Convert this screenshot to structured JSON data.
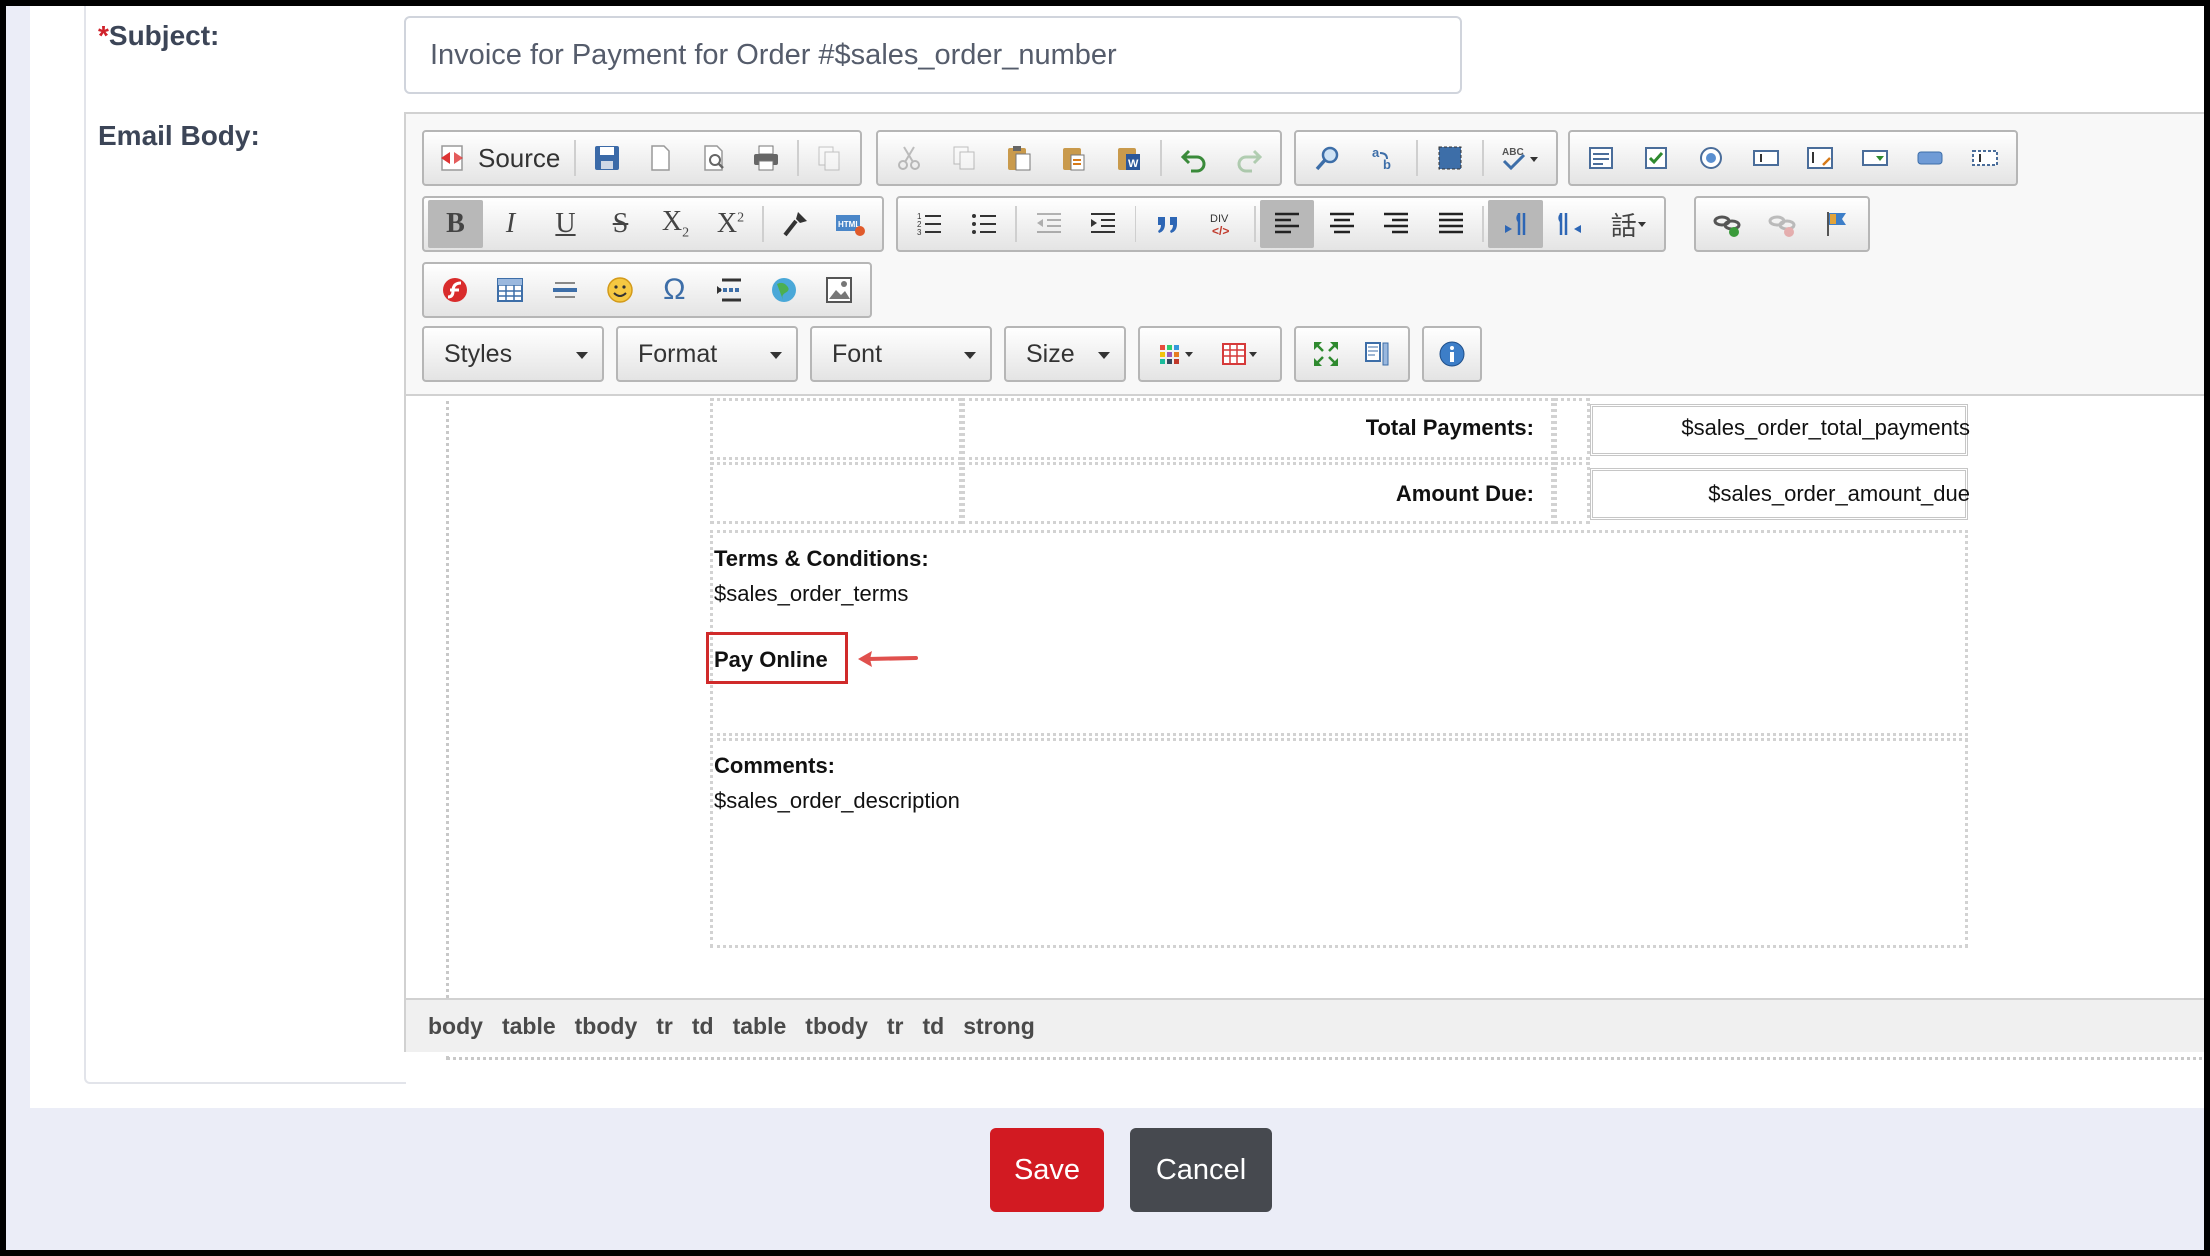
{
  "form": {
    "subject_required_mark": "*",
    "subject_label": "Subject:",
    "subject_value": "Invoice for Payment for Order #$sales_order_number",
    "body_label": "Email Body:"
  },
  "toolbar": {
    "source_label": "Source",
    "styles_label": "Styles",
    "format_label": "Format",
    "font_label": "Font",
    "size_label": "Size",
    "icons_row1": [
      "save-icon",
      "new-page-icon",
      "preview-icon",
      "print-icon",
      "templates-icon",
      "cut-icon",
      "copy-icon",
      "paste-icon",
      "paste-text-icon",
      "paste-word-icon",
      "undo-icon",
      "redo-icon",
      "find-icon",
      "replace-icon",
      "select-all-icon",
      "spellcheck-icon",
      "form-icon",
      "checkbox-icon",
      "radio-icon",
      "textfield-icon",
      "textarea-icon",
      "select-field-icon",
      "button-icon",
      "hidden-field-icon"
    ],
    "icons_row2": [
      "bold-icon",
      "italic-icon",
      "underline-icon",
      "strike-icon",
      "subscript-icon",
      "superscript-icon",
      "copy-format-icon",
      "remove-format-icon",
      "numbered-list-icon",
      "bulleted-list-icon",
      "outdent-icon",
      "indent-icon",
      "blockquote-icon",
      "div-icon",
      "align-left-icon",
      "align-center-icon",
      "align-right-icon",
      "justify-icon",
      "ltr-icon",
      "rtl-icon",
      "language-icon",
      "link-icon",
      "unlink-icon",
      "anchor-icon"
    ],
    "icons_row3": [
      "flash-icon",
      "table-icon",
      "horizontal-rule-icon",
      "smiley-icon",
      "special-char-icon",
      "page-break-icon",
      "iframe-icon",
      "image-icon"
    ],
    "text_color_icon": "text-color-icon",
    "bg_color_icon": "bg-color-icon",
    "maximize_icon": "maximize-icon",
    "show-blocks-icon": "show-blocks-icon",
    "about_icon": "about-icon"
  },
  "content": {
    "total_payments_label": "Total Payments:",
    "total_payments_value": "$sales_order_total_payments",
    "amount_due_label": "Amount Due:",
    "amount_due_value": "$sales_order_amount_due",
    "terms_label": "Terms & Conditions:",
    "terms_value": "$sales_order_terms",
    "pay_online": "Pay Online",
    "comments_label": "Comments:",
    "comments_value": "$sales_order_description"
  },
  "pathbar": [
    "body",
    "table",
    "tbody",
    "tr",
    "td",
    "table",
    "tbody",
    "tr",
    "td",
    "strong"
  ],
  "actions": {
    "save_label": "Save",
    "cancel_label": "Cancel"
  },
  "colors": {
    "save": "#d21a22",
    "cancel": "#46494f",
    "highlight": "#d93434",
    "required": "#d0212a"
  }
}
